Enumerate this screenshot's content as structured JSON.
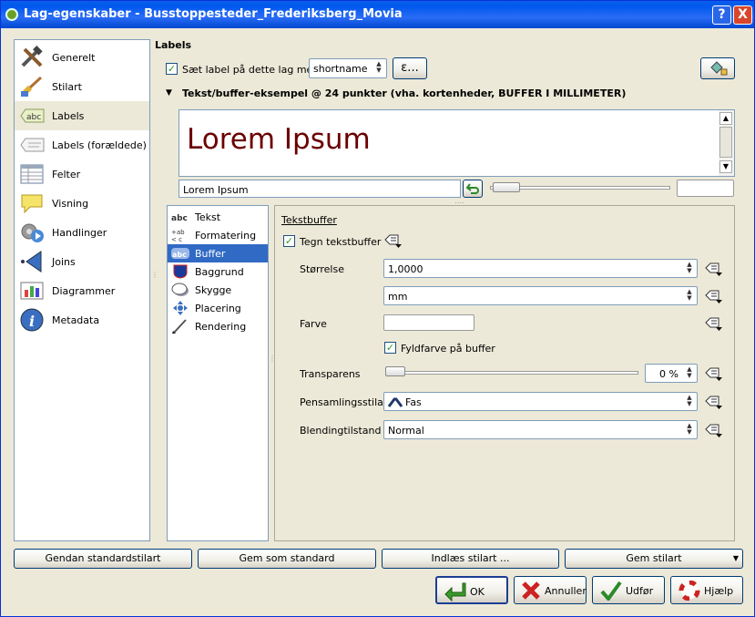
{
  "window": {
    "title": "Lag-egenskaber - Busstoppesteder_Frederiksberg_Movia",
    "help_btn": "?",
    "close_btn": "X"
  },
  "sidebar": {
    "items": [
      {
        "label": "Generelt"
      },
      {
        "label": "Stilart"
      },
      {
        "label": "Labels"
      },
      {
        "label": "Labels (forældede)"
      },
      {
        "label": "Felter"
      },
      {
        "label": "Visning"
      },
      {
        "label": "Handlinger"
      },
      {
        "label": "Joins"
      },
      {
        "label": "Diagrammer"
      },
      {
        "label": "Metadata"
      }
    ]
  },
  "labels_section": {
    "heading": "Labels",
    "enable_label": "Sæt label på dette lag med",
    "enable_checked": true,
    "field_value": "shortname",
    "expr_button": "ε...",
    "preview_header": "Tekst/buffer-eksempel @ 24 punkter (vha. kortenheder, BUFFER I MILLIMETER)",
    "preview_text": "Lorem Ipsum",
    "sample_input": "Lorem Ipsum"
  },
  "tabs": [
    {
      "label": "Tekst"
    },
    {
      "label": "Formatering"
    },
    {
      "label": "Buffer"
    },
    {
      "label": "Baggrund"
    },
    {
      "label": "Skygge"
    },
    {
      "label": "Placering"
    },
    {
      "label": "Rendering"
    }
  ],
  "buffer_panel": {
    "title": "Tekstbuffer",
    "draw_buffer": "Tegn tekstbuffer",
    "size_label": "Størrelse",
    "size_value": "1,0000",
    "unit_value": "mm",
    "color_label": "Farve",
    "fill_color": "Fyldfarve på buffer",
    "transparency_label": "Transparens",
    "transparency_value": "0 %",
    "transparency_level": 0,
    "join_label": "Pensamlingsstilart",
    "join_value": "Fas",
    "blend_label": "Blendingtilstand",
    "blend_value": "Normal"
  },
  "bottom": {
    "restore": "Gendan standardstilart",
    "save_default": "Gem som standard",
    "load_style": "Indlæs stilart ...",
    "save_style": "Gem stilart",
    "ok": "OK",
    "cancel": "Annuller",
    "apply": "Udfør",
    "help": "Hjælp"
  },
  "colors": {
    "titlebar": "#0058ee",
    "selection": "#316ac5",
    "preview_text": "#6b0000",
    "background": "#ece9d8"
  }
}
